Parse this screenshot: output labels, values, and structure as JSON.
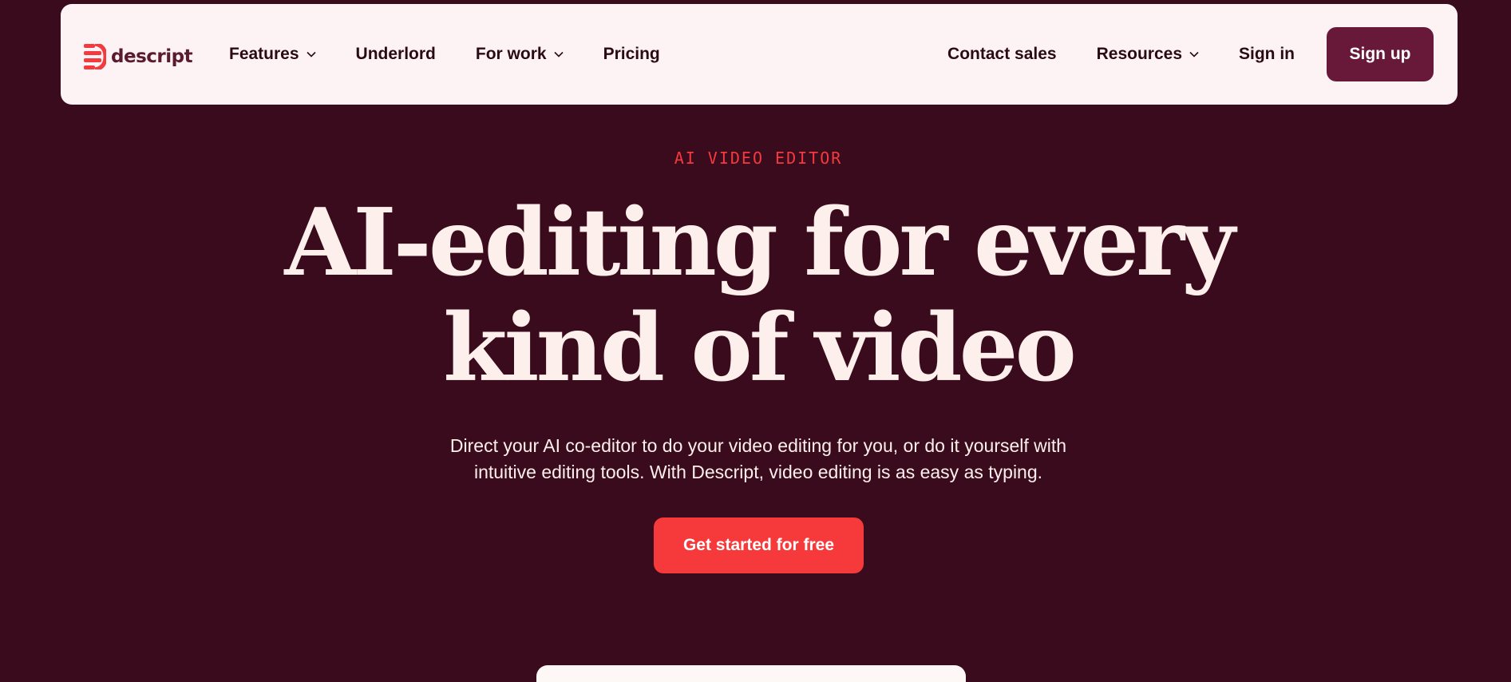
{
  "brand": {
    "name": "descript",
    "accent": "#f33a3e",
    "background": "#3a0b1c",
    "nav_background": "#fdf3f5",
    "signup_color": "#681838"
  },
  "nav": {
    "left_items": [
      {
        "label": "Features",
        "has_dropdown": true
      },
      {
        "label": "Underlord",
        "has_dropdown": false
      },
      {
        "label": "For work",
        "has_dropdown": true
      },
      {
        "label": "Pricing",
        "has_dropdown": false
      }
    ],
    "right_items": [
      {
        "label": "Contact sales",
        "has_dropdown": false
      },
      {
        "label": "Resources",
        "has_dropdown": true
      },
      {
        "label": "Sign in",
        "has_dropdown": false
      }
    ],
    "signup_label": "Sign up"
  },
  "hero": {
    "eyebrow": "AI VIDEO EDITOR",
    "headline_line1": "AI-editing for every",
    "headline_line2": "kind of video",
    "subtext_line1": "Direct your AI co-editor to do your video editing for you, or do it yourself with",
    "subtext_line2": "intuitive editing tools. With Descript, video editing is as easy as typing.",
    "cta_label": "Get started for free"
  },
  "icons": {
    "logo": "descript-logo-icon",
    "dropdown": "chevron-down-icon"
  }
}
